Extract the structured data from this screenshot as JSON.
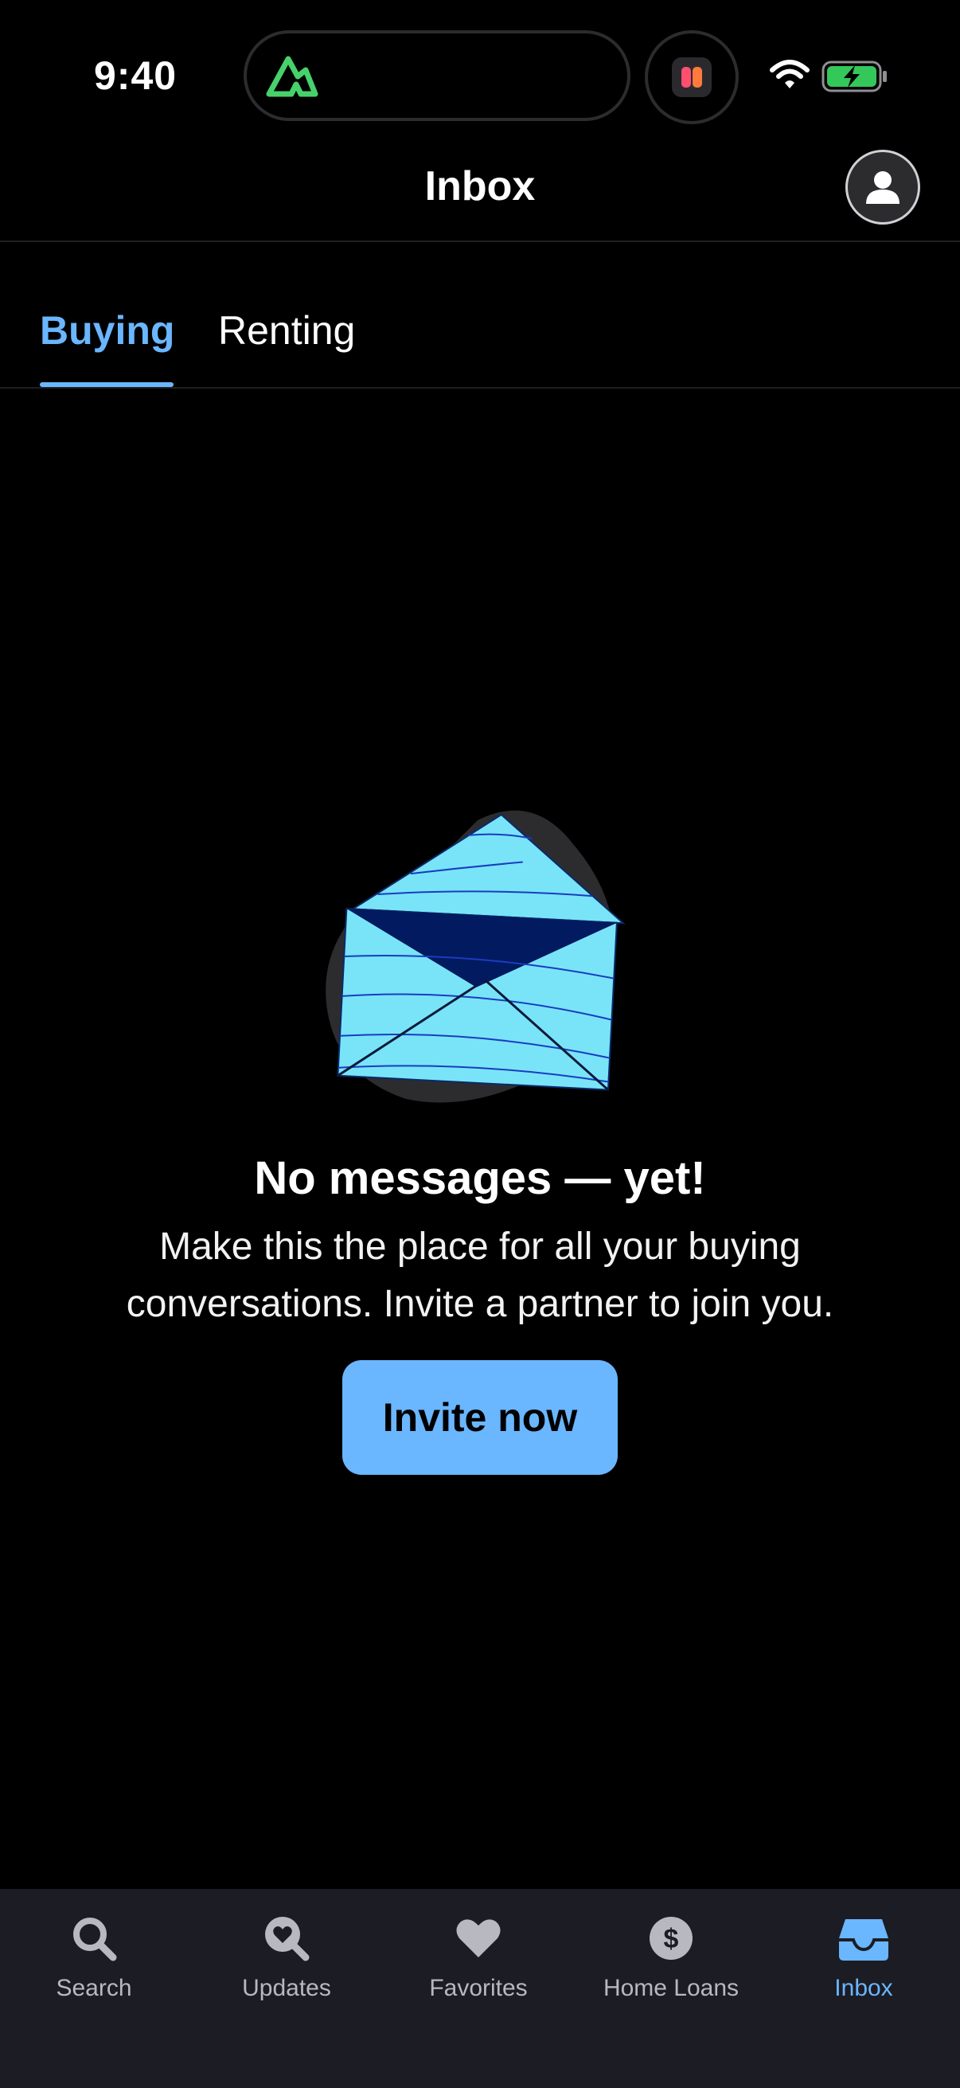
{
  "status_bar": {
    "time": "9:40"
  },
  "header": {
    "title": "Inbox"
  },
  "tabs": [
    {
      "label": "Buying",
      "active": true
    },
    {
      "label": "Renting",
      "active": false
    }
  ],
  "empty_state": {
    "title": "No messages — yet!",
    "text": "Make this the place for all your buying conversations. Invite a partner to join you.",
    "button": "Invite now"
  },
  "tab_bar": [
    {
      "label": "Search",
      "icon": "search-icon"
    },
    {
      "label": "Updates",
      "icon": "updates-icon"
    },
    {
      "label": "Favorites",
      "icon": "heart-icon"
    },
    {
      "label": "Home Loans",
      "icon": "dollar-icon"
    },
    {
      "label": "Inbox",
      "icon": "inbox-icon",
      "active": true
    }
  ],
  "colors": {
    "accent": "#6ab6ff",
    "background": "#000000",
    "tab_bar_bg": "#1c1c24",
    "inactive": "#b8b8c0",
    "envelope_light": "#79e4f8",
    "envelope_dark": "#021a5f"
  }
}
